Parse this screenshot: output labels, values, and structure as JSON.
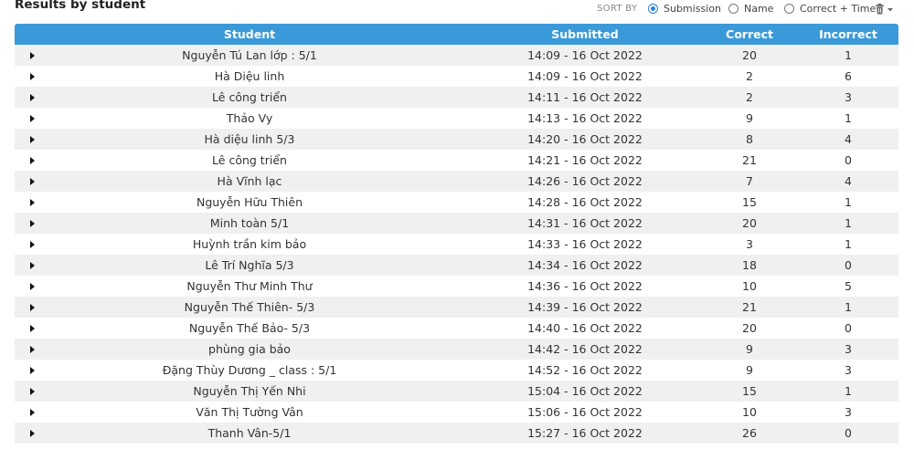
{
  "header": {
    "title": "Results by student",
    "sort_label": "SORT BY",
    "sort_options": [
      {
        "label": "Submission",
        "checked": true
      },
      {
        "label": "Name",
        "checked": false
      },
      {
        "label": "Correct + Time",
        "checked": false
      }
    ],
    "icons": {
      "delete": "trash-icon",
      "dropdown": "caret-down-icon",
      "expand": "triangle-right-icon"
    }
  },
  "colors": {
    "header_bg": "#3a9ad9",
    "radio_accent": "#2a7fd4",
    "row_odd": "#f0f0f0",
    "row_even": "#ffffff"
  },
  "table": {
    "columns": {
      "student": "Student",
      "submitted": "Submitted",
      "correct": "Correct",
      "incorrect": "Incorrect"
    },
    "rows": [
      {
        "student": "Nguyễn Tú Lan lớp : 5/1",
        "submitted": "14:09 - 16 Oct 2022",
        "correct": "20",
        "incorrect": "1"
      },
      {
        "student": "Hà Diệu linh",
        "submitted": "14:09 - 16 Oct 2022",
        "correct": "2",
        "incorrect": "6"
      },
      {
        "student": "Lê công triển",
        "submitted": "14:11 - 16 Oct 2022",
        "correct": "2",
        "incorrect": "3"
      },
      {
        "student": "Thảo Vy",
        "submitted": "14:13 - 16 Oct 2022",
        "correct": "9",
        "incorrect": "1"
      },
      {
        "student": "Hà diệu linh 5/3",
        "submitted": "14:20 - 16 Oct 2022",
        "correct": "8",
        "incorrect": "4"
      },
      {
        "student": "Lê công triển",
        "submitted": "14:21 - 16 Oct 2022",
        "correct": "21",
        "incorrect": "0"
      },
      {
        "student": "Hà Vĩnh lạc",
        "submitted": "14:26 - 16 Oct 2022",
        "correct": "7",
        "incorrect": "4"
      },
      {
        "student": "Nguyễn Hữu Thiên",
        "submitted": "14:28 - 16 Oct 2022",
        "correct": "15",
        "incorrect": "1"
      },
      {
        "student": "Minh toàn 5/1",
        "submitted": "14:31 - 16 Oct 2022",
        "correct": "20",
        "incorrect": "1"
      },
      {
        "student": "Huỳnh trần kim bảo",
        "submitted": "14:33 - 16 Oct 2022",
        "correct": "3",
        "incorrect": "1"
      },
      {
        "student": "Lê Trí Nghĩa 5/3",
        "submitted": "14:34 - 16 Oct 2022",
        "correct": "18",
        "incorrect": "0"
      },
      {
        "student": "Nguyễn Thư Minh Thư",
        "submitted": "14:36 - 16 Oct 2022",
        "correct": "10",
        "incorrect": "5"
      },
      {
        "student": "Nguyễn Thế Thiên- 5/3",
        "submitted": "14:39 - 16 Oct 2022",
        "correct": "21",
        "incorrect": "1"
      },
      {
        "student": "Nguyễn Thế Bảo- 5/3",
        "submitted": "14:40 - 16 Oct 2022",
        "correct": "20",
        "incorrect": "0"
      },
      {
        "student": "phùng gia bảo",
        "submitted": "14:42 - 16 Oct 2022",
        "correct": "9",
        "incorrect": "3"
      },
      {
        "student": "Đặng Thùy Dương _ class : 5/1",
        "submitted": "14:52 - 16 Oct 2022",
        "correct": "9",
        "incorrect": "3"
      },
      {
        "student": "Nguyễn Thị Yến Nhi",
        "submitted": "15:04 - 16 Oct 2022",
        "correct": "15",
        "incorrect": "1"
      },
      {
        "student": "Văn Thị Tường Vân",
        "submitted": "15:06 - 16 Oct 2022",
        "correct": "10",
        "incorrect": "3"
      },
      {
        "student": "Thanh Vân-5/1",
        "submitted": "15:27 - 16 Oct 2022",
        "correct": "26",
        "incorrect": "0"
      }
    ]
  }
}
